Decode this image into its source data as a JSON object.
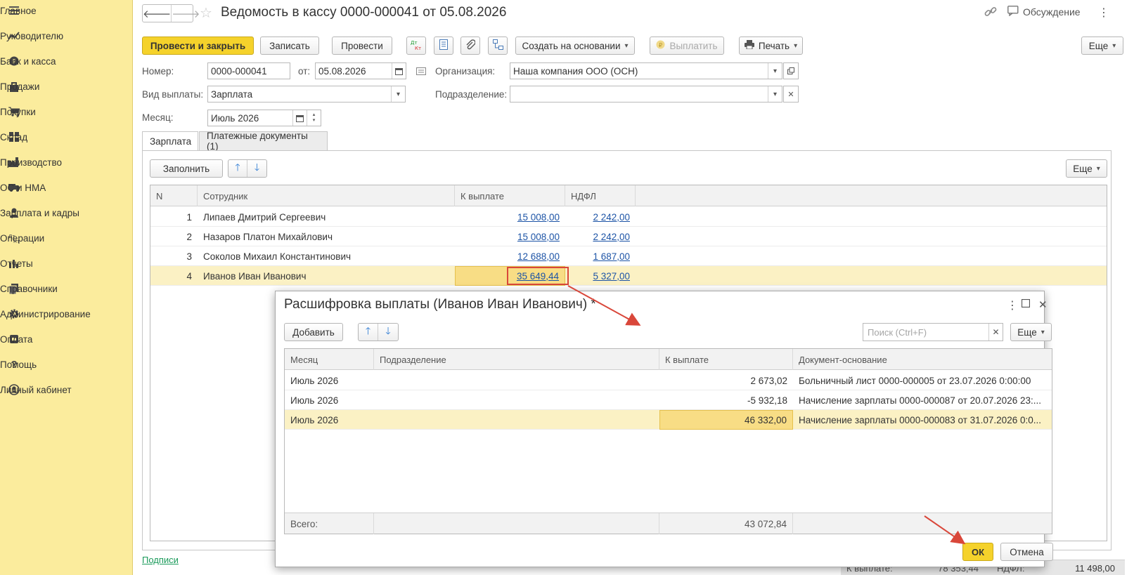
{
  "sidebar": {
    "items": [
      {
        "label": "Главное",
        "icon": "menu-icon"
      },
      {
        "label": "Руководителю",
        "icon": "chart-line-icon"
      },
      {
        "label": "Банк и касса",
        "icon": "coins-icon"
      },
      {
        "label": "Продажи",
        "icon": "bag-icon"
      },
      {
        "label": "Покупки",
        "icon": "cart-icon"
      },
      {
        "label": "Склад",
        "icon": "warehouse-icon"
      },
      {
        "label": "Производство",
        "icon": "factory-icon"
      },
      {
        "label": "ОС и НМА",
        "icon": "truck-icon"
      },
      {
        "label": "Зарплата и кадры",
        "icon": "person-icon"
      },
      {
        "label": "Операции",
        "icon": "dt-kt-icon"
      },
      {
        "label": "Отчеты",
        "icon": "bar-chart-icon"
      },
      {
        "label": "Справочники",
        "icon": "books-icon"
      },
      {
        "label": "Администрирование",
        "icon": "gear-icon"
      },
      {
        "label": "Оплата",
        "icon": "payment-icon"
      },
      {
        "label": "Помощь",
        "icon": "question-icon"
      },
      {
        "label": "Личный кабинет",
        "icon": "account-icon"
      }
    ]
  },
  "header": {
    "title": "Ведомость в кассу 0000-000041 от 05.08.2026",
    "discussion": "Обсуждение"
  },
  "toolbar": {
    "post_close": "Провести и закрыть",
    "save": "Записать",
    "post": "Провести",
    "dtkt": "Дт Кт",
    "create_based": "Создать на основании",
    "pay": "Выплатить",
    "print": "Печать",
    "more": "Еще"
  },
  "form": {
    "number_label": "Номер:",
    "number": "0000-000041",
    "date_label": "от:",
    "date": "05.08.2026",
    "org_label": "Организация:",
    "org": "Наша компания ООО (ОСН)",
    "pay_type_label": "Вид выплаты:",
    "pay_type": "Зарплата",
    "dept_label": "Подразделение:",
    "dept": "",
    "month_label": "Месяц:",
    "month": "Июль 2026"
  },
  "tabs": [
    {
      "label": "Зарплата"
    },
    {
      "label": "Платежные документы (1)"
    }
  ],
  "tab_toolbar": {
    "fill": "Заполнить",
    "more": "Еще"
  },
  "main_table": {
    "headers": [
      "N",
      "Сотрудник",
      "К выплате",
      "НДФЛ"
    ],
    "rows": [
      {
        "n": "1",
        "name": "Липаев Дмитрий Сергеевич",
        "pay": "15 008,00",
        "ndfl": "2 242,00"
      },
      {
        "n": "2",
        "name": "Назаров Платон Михайлович",
        "pay": "15 008,00",
        "ndfl": "2 242,00"
      },
      {
        "n": "3",
        "name": "Соколов Михаил Константинович",
        "pay": "12 688,00",
        "ndfl": "1 687,00"
      },
      {
        "n": "4",
        "name": "Иванов Иван Иванович",
        "pay": "35 649,44",
        "ndfl": "5 327,00"
      }
    ]
  },
  "signatures_link": "Подписи",
  "bottom": {
    "pay_label": "К выплате:",
    "pay_value": "78 353,44",
    "ndfl_label": "НДФЛ:",
    "ndfl_value": "11 498,00"
  },
  "dialog": {
    "title": "Расшифровка выплаты (Иванов Иван Иванович) *",
    "add": "Добавить",
    "search_placeholder": "Поиск (Ctrl+F)",
    "more": "Еще",
    "headers": [
      "Месяц",
      "Подразделение",
      "К выплате",
      "Документ-основание"
    ],
    "rows": [
      {
        "month": "Июль 2026",
        "dept": "",
        "pay": "2 673,02",
        "doc": "Больничный лист 0000-000005 от 23.07.2026 0:00:00",
        "negative": false
      },
      {
        "month": "Июль 2026",
        "dept": "",
        "pay": "-5 932,18",
        "doc": "Начисление зарплаты 0000-000087 от 20.07.2026 23:...",
        "negative": true
      },
      {
        "month": "Июль 2026",
        "dept": "",
        "pay": "46 332,00",
        "doc": "Начисление зарплаты 0000-000083 от 31.07.2026 0:0...",
        "negative": false
      }
    ],
    "total_label": "Всего:",
    "total_value": "43 072,84",
    "ok": "ОК",
    "cancel": "Отмена"
  },
  "colors": {
    "sidebar_bg": "#fbec9d",
    "primary_button": "#f5d22b",
    "link": "#1d54a6",
    "negative": "#d52b2b",
    "highlight_row": "#fbf1c4",
    "annotation": "#d9473a"
  }
}
